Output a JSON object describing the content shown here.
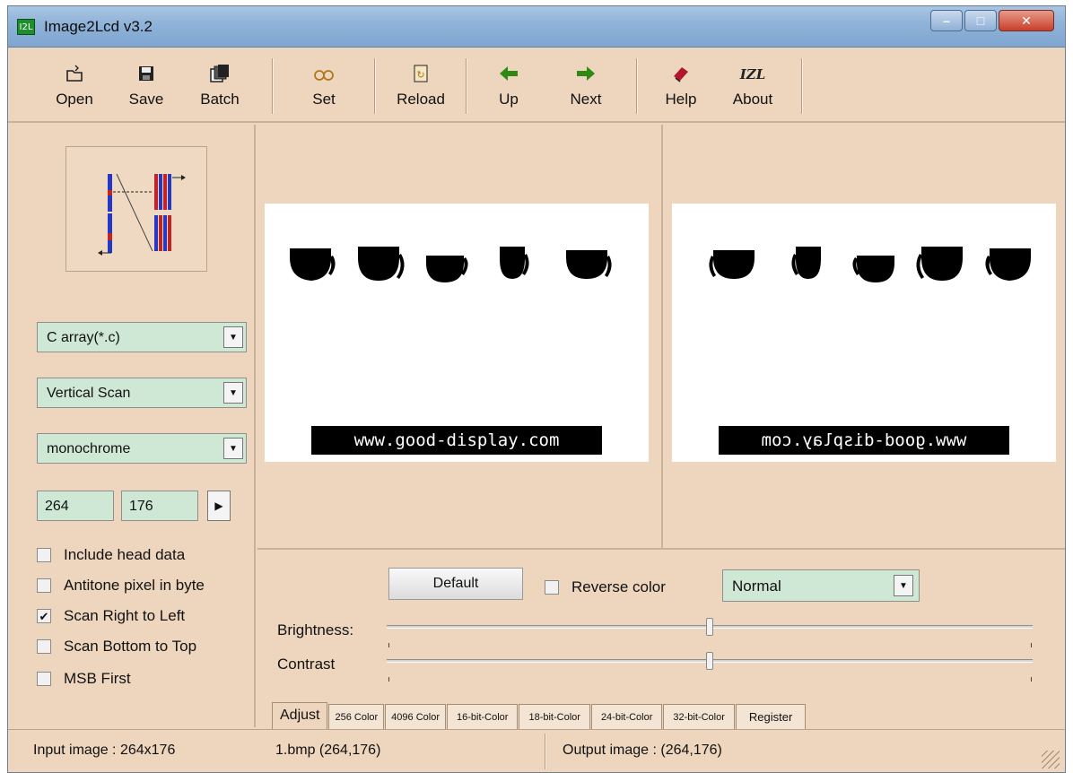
{
  "window": {
    "title": "Image2Lcd v3.2",
    "app_icon_text": "I2L",
    "minimize": "–",
    "maximize": "□",
    "close": "✕"
  },
  "toolbar": {
    "open": "Open",
    "save": "Save",
    "batch": "Batch",
    "set": "Set",
    "reload": "Reload",
    "up": "Up",
    "next": "Next",
    "help": "Help",
    "about": "About",
    "about_icon_text": "IZL"
  },
  "left": {
    "output_type": "C array(*.c)",
    "scan_mode": "Vertical Scan",
    "color_mode": "monochrome",
    "width": "264",
    "height": "176",
    "options": [
      {
        "label": "Include head data",
        "checked": false
      },
      {
        "label": "Antitone pixel in byte",
        "checked": false
      },
      {
        "label": "Scan Right to Left",
        "checked": true
      },
      {
        "label": "Scan Bottom to Top",
        "checked": false
      },
      {
        "label": "MSB First",
        "checked": false
      }
    ]
  },
  "preview": {
    "input_caption": "www.good-display.com",
    "output_caption": "www.good-display.com"
  },
  "adjust": {
    "default_label": "Default",
    "reverse_color_label": "Reverse color",
    "reverse_color_checked": false,
    "mode": "Normal",
    "brightness_label": "Brightness:",
    "contrast_label": "Contrast",
    "brightness_level": 0.5,
    "contrast_level": 0.5
  },
  "tabs": [
    "Adjust",
    "256 Color",
    "4096 Color",
    "16-bit-Color",
    "18-bit-Color",
    "24-bit-Color",
    "32-bit-Color",
    "Register"
  ],
  "status": {
    "input": "Input image : 264x176",
    "file": "1.bmp  (264,176)",
    "output": "Output image : (264,176)"
  }
}
